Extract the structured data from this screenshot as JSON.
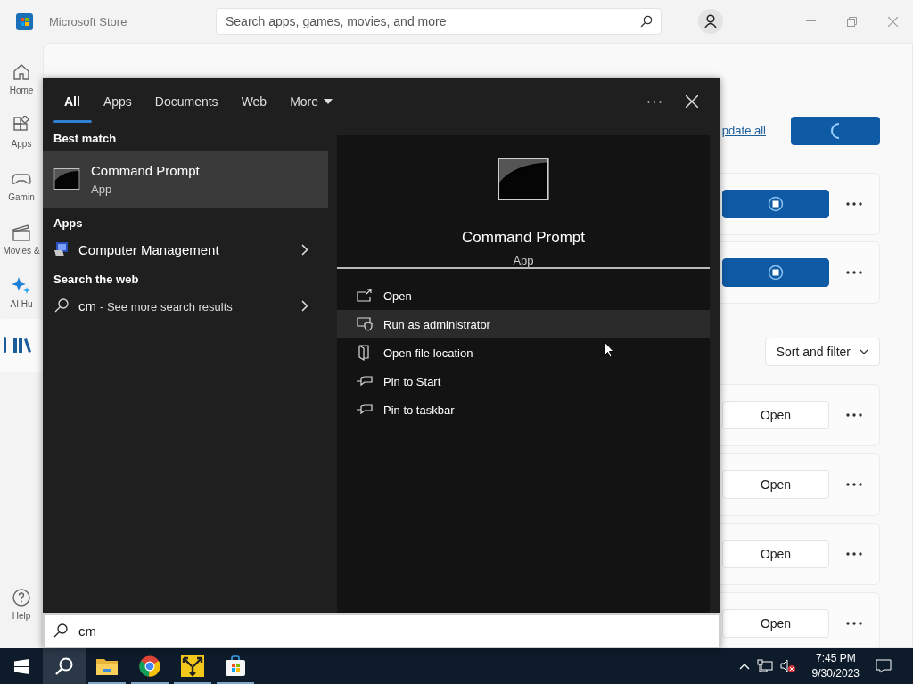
{
  "store": {
    "title": "Microsoft Store",
    "search_placeholder": "Search apps, games, movies, and more",
    "nav": [
      {
        "kind": "home",
        "label": "Home",
        "selected": false
      },
      {
        "kind": "apps",
        "label": "Apps",
        "selected": false
      },
      {
        "kind": "gaming",
        "label": "Gamin",
        "selected": false
      },
      {
        "kind": "movies",
        "label": "Movies &",
        "selected": false
      },
      {
        "kind": "ai",
        "label": "AI Hu",
        "selected": false
      },
      {
        "kind": "library",
        "selected": true
      },
      {
        "kind": "help",
        "label": "Help",
        "selected": false
      }
    ],
    "update_link": "pdate all",
    "sort_filter": "Sort and filter",
    "cards_top": [
      {
        "kind": "downloading"
      },
      {
        "kind": "downloading"
      }
    ],
    "cards_bottom": [
      {
        "kind": "open",
        "button": "Open"
      },
      {
        "kind": "open",
        "button": "Open"
      },
      {
        "kind": "open",
        "button": "Open"
      },
      {
        "kind": "open",
        "button": "Open"
      }
    ]
  },
  "search_panel": {
    "tabs": [
      {
        "label": "All",
        "selected": true,
        "dropdown": false
      },
      {
        "label": "Apps",
        "selected": false,
        "dropdown": false
      },
      {
        "label": "Documents",
        "selected": false,
        "dropdown": false
      },
      {
        "label": "Web",
        "selected": false,
        "dropdown": false
      },
      {
        "label": "More",
        "selected": false,
        "dropdown": true
      }
    ],
    "sections": [
      {
        "header": "Best match",
        "items": [
          {
            "kind": "app",
            "title": "Command Prompt",
            "subtitle": "App",
            "selected": true
          }
        ]
      },
      {
        "header": "Apps",
        "items": [
          {
            "kind": "tool",
            "title": "Computer Management",
            "selected": false
          }
        ]
      },
      {
        "header": "Search the web",
        "items": [
          {
            "kind": "web",
            "query": "cm",
            "suffix": "- See more search results",
            "selected": false
          }
        ]
      }
    ],
    "preview": {
      "title": "Command Prompt",
      "subtitle": "App",
      "actions": [
        {
          "kind": "open",
          "label": "Open",
          "highlighted": false
        },
        {
          "kind": "admin",
          "label": "Run as administrator",
          "highlighted": true
        },
        {
          "kind": "location",
          "label": "Open file location",
          "highlighted": false
        },
        {
          "kind": "pin",
          "label": "Pin to Start",
          "highlighted": false
        },
        {
          "kind": "pin",
          "label": "Pin to taskbar",
          "highlighted": false
        }
      ]
    },
    "query": "cm"
  },
  "taskbar": {
    "items": [
      {
        "kind": "start",
        "selected": false,
        "running": false
      },
      {
        "kind": "search",
        "selected": true,
        "running": false
      },
      {
        "kind": "folder",
        "selected": false,
        "running": true
      },
      {
        "kind": "browser",
        "selected": false,
        "running": true
      },
      {
        "kind": "arrows",
        "selected": false,
        "running": true
      },
      {
        "kind": "store",
        "selected": false,
        "running": true
      }
    ],
    "time": "7:45 PM",
    "date": "9/30/2023"
  }
}
